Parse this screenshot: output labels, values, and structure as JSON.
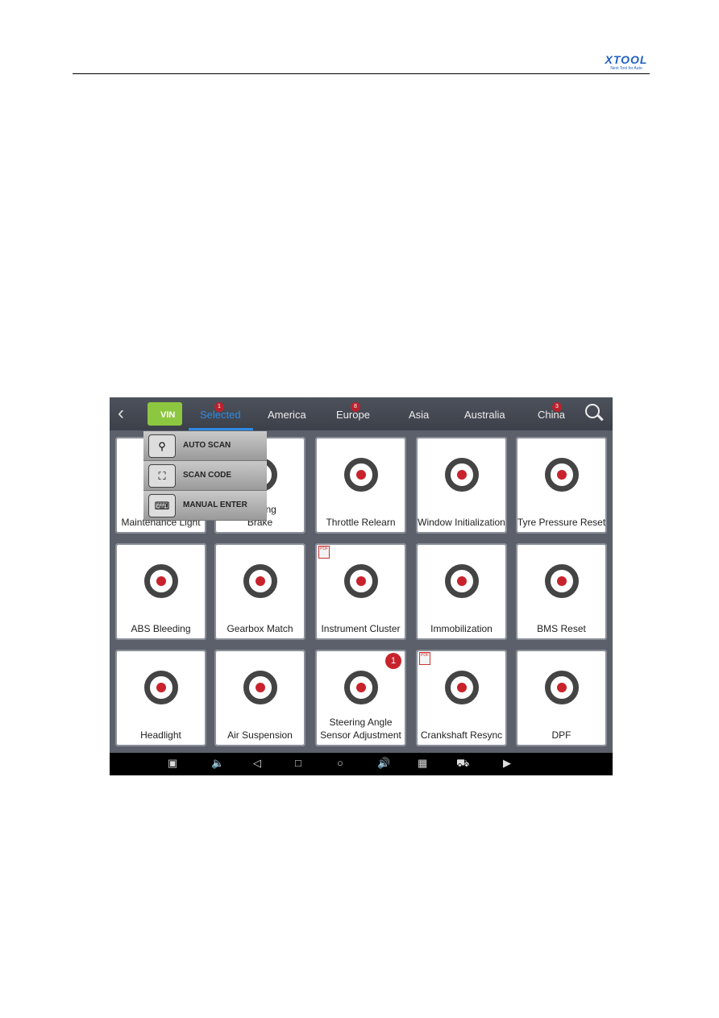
{
  "header": {
    "logo": "XTOOL",
    "logo_tagline": "Next Tool for Auto"
  },
  "topbar": {
    "vin_label": "VIN",
    "tabs": [
      {
        "label": "Selected",
        "badge": "1",
        "active": true
      },
      {
        "label": "America",
        "badge": null
      },
      {
        "label": "Europe",
        "badge": "8"
      },
      {
        "label": "Asia",
        "badge": null
      },
      {
        "label": "Australia",
        "badge": null
      },
      {
        "label": "China",
        "badge": "3"
      }
    ]
  },
  "vin_menu": [
    {
      "label": "AUTO SCAN",
      "icon": "magnifier-icon"
    },
    {
      "label": "SCAN CODE",
      "icon": "scan-frame-icon"
    },
    {
      "label": "MANUAL ENTER",
      "icon": "keyboard-icon"
    }
  ],
  "tiles": [
    {
      "label": "Service Maintenance Light",
      "visible_label": "S\nMaintenance Light"
    },
    {
      "label": "Electronic Parking Brake",
      "visible_label": "Parking\nBrake"
    },
    {
      "label": "Throttle Relearn"
    },
    {
      "label": "Window Initialization"
    },
    {
      "label": "Tyre Pressure Reset"
    },
    {
      "label": "ABS Bleeding"
    },
    {
      "label": "Gearbox Match"
    },
    {
      "label": "Instrument Cluster",
      "pdf": true
    },
    {
      "label": "Immobilization"
    },
    {
      "label": "BMS Reset"
    },
    {
      "label": "Headlight"
    },
    {
      "label": "Air Suspension"
    },
    {
      "label": "Steering Angle Sensor Adjustment",
      "badge": "1"
    },
    {
      "label": "Crankshaft Resync",
      "pdf": true
    },
    {
      "label": "DPF"
    }
  ],
  "navbar": [
    "screenshot-icon",
    "volume-down-icon",
    "back-icon",
    "recents-icon",
    "home-icon",
    "volume-up-icon",
    "vci-icon",
    "truck-icon",
    "play-icon"
  ],
  "colors": {
    "accent": "#2e8be6",
    "vin_green": "#8dc63f",
    "badge_red": "#c8232c"
  }
}
